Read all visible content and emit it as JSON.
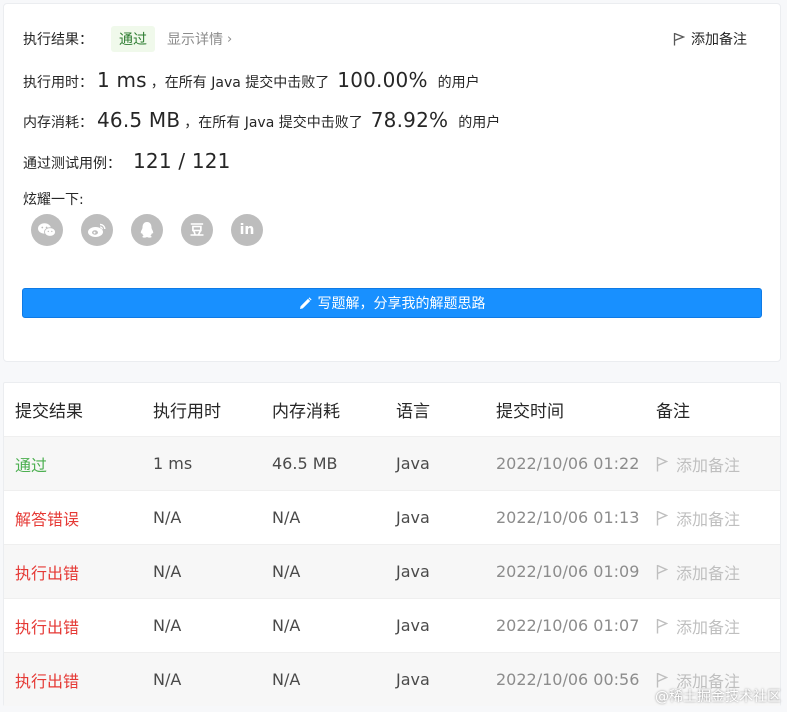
{
  "result": {
    "exec_result_label": "执行结果：",
    "status_badge": "通过",
    "show_details": "显示详情",
    "add_note": "添加备注",
    "runtime_label": "执行用时：",
    "runtime_value": "1 ms",
    "runtime_mid": "，在所有 Java 提交中击败了",
    "runtime_pct": "100.00%",
    "runtime_suffix": "的用户",
    "memory_label": "内存消耗：",
    "memory_value": "46.5 MB",
    "memory_mid": "，在所有 Java 提交中击败了",
    "memory_pct": "78.92%",
    "memory_suffix": "的用户",
    "tests_label": "通过测试用例：",
    "tests_value": "121 / 121",
    "share_label": "炫耀一下:",
    "share_icons": [
      "wechat-icon",
      "weibo-icon",
      "qq-icon",
      "douban-icon",
      "linkedin-icon"
    ],
    "douban_glyph": "豆",
    "linkedin_glyph": "in",
    "write_button": "写题解，分享我的解题思路"
  },
  "table": {
    "headers": [
      "提交结果",
      "执行用时",
      "内存消耗",
      "语言",
      "提交时间",
      "备注"
    ],
    "rows": [
      {
        "result": "通过",
        "status": "ok",
        "time": "1 ms",
        "memory": "46.5 MB",
        "lang": "Java",
        "submitted": "2022/10/06 01:22",
        "note": "添加备注"
      },
      {
        "result": "解答错误",
        "status": "err",
        "time": "N/A",
        "memory": "N/A",
        "lang": "Java",
        "submitted": "2022/10/06 01:13",
        "note": "添加备注"
      },
      {
        "result": "执行出错",
        "status": "err",
        "time": "N/A",
        "memory": "N/A",
        "lang": "Java",
        "submitted": "2022/10/06 01:09",
        "note": "添加备注"
      },
      {
        "result": "执行出错",
        "status": "err",
        "time": "N/A",
        "memory": "N/A",
        "lang": "Java",
        "submitted": "2022/10/06 01:07",
        "note": "添加备注"
      },
      {
        "result": "执行出错",
        "status": "err",
        "time": "N/A",
        "memory": "N/A",
        "lang": "Java",
        "submitted": "2022/10/06 00:56",
        "note": "添加备注"
      }
    ]
  },
  "watermark": "@稀土掘金技术社区",
  "colors": {
    "accent": "#1890ff",
    "success": "#4caf50",
    "error": "#e53935"
  }
}
